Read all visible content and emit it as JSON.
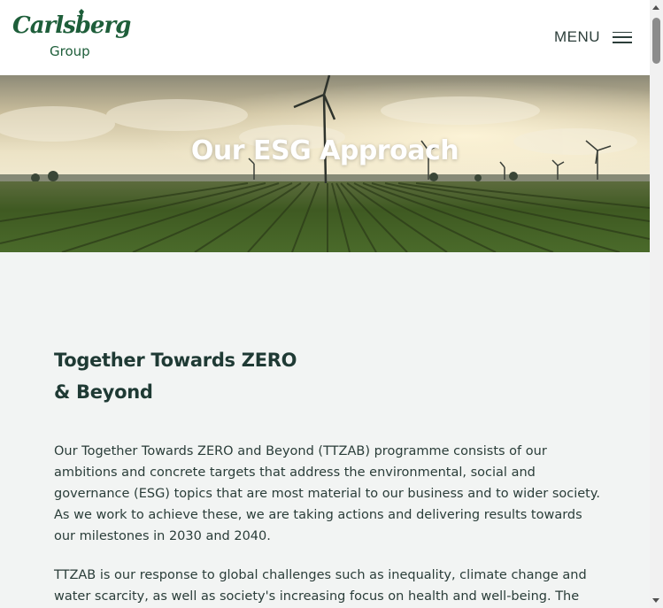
{
  "header": {
    "logo_text": "Carlsberg",
    "logo_subtext": "Group",
    "menu_label": "MENU"
  },
  "hero": {
    "title": "Our ESG Approach"
  },
  "section": {
    "heading_line1": "Together Towards ZERO",
    "heading_line2": "& Beyond",
    "paragraph1": "Our Together Towards ZERO and Beyond (TTZAB) programme consists of our ambitions and concrete targets that address the environmental, social and governance (ESG) topics that are most material to our business and to wider society. As we work to achieve these, we are taking actions and delivering results towards our milestones in 2030 and 2040.",
    "paragraph2": "TTZAB is our response to global challenges such as inequality, climate change and water scarcity, as well as society's increasing focus on health and well-being. The"
  },
  "colors": {
    "brand_green": "#1e5e3a",
    "heading_text": "#1f3a34",
    "body_text": "#2a3d39",
    "page_background": "#f2f4f3"
  },
  "icons": {
    "menu": "hamburger-icon",
    "scroll_up": "arrow-up-icon",
    "scroll_down": "arrow-down-icon"
  }
}
